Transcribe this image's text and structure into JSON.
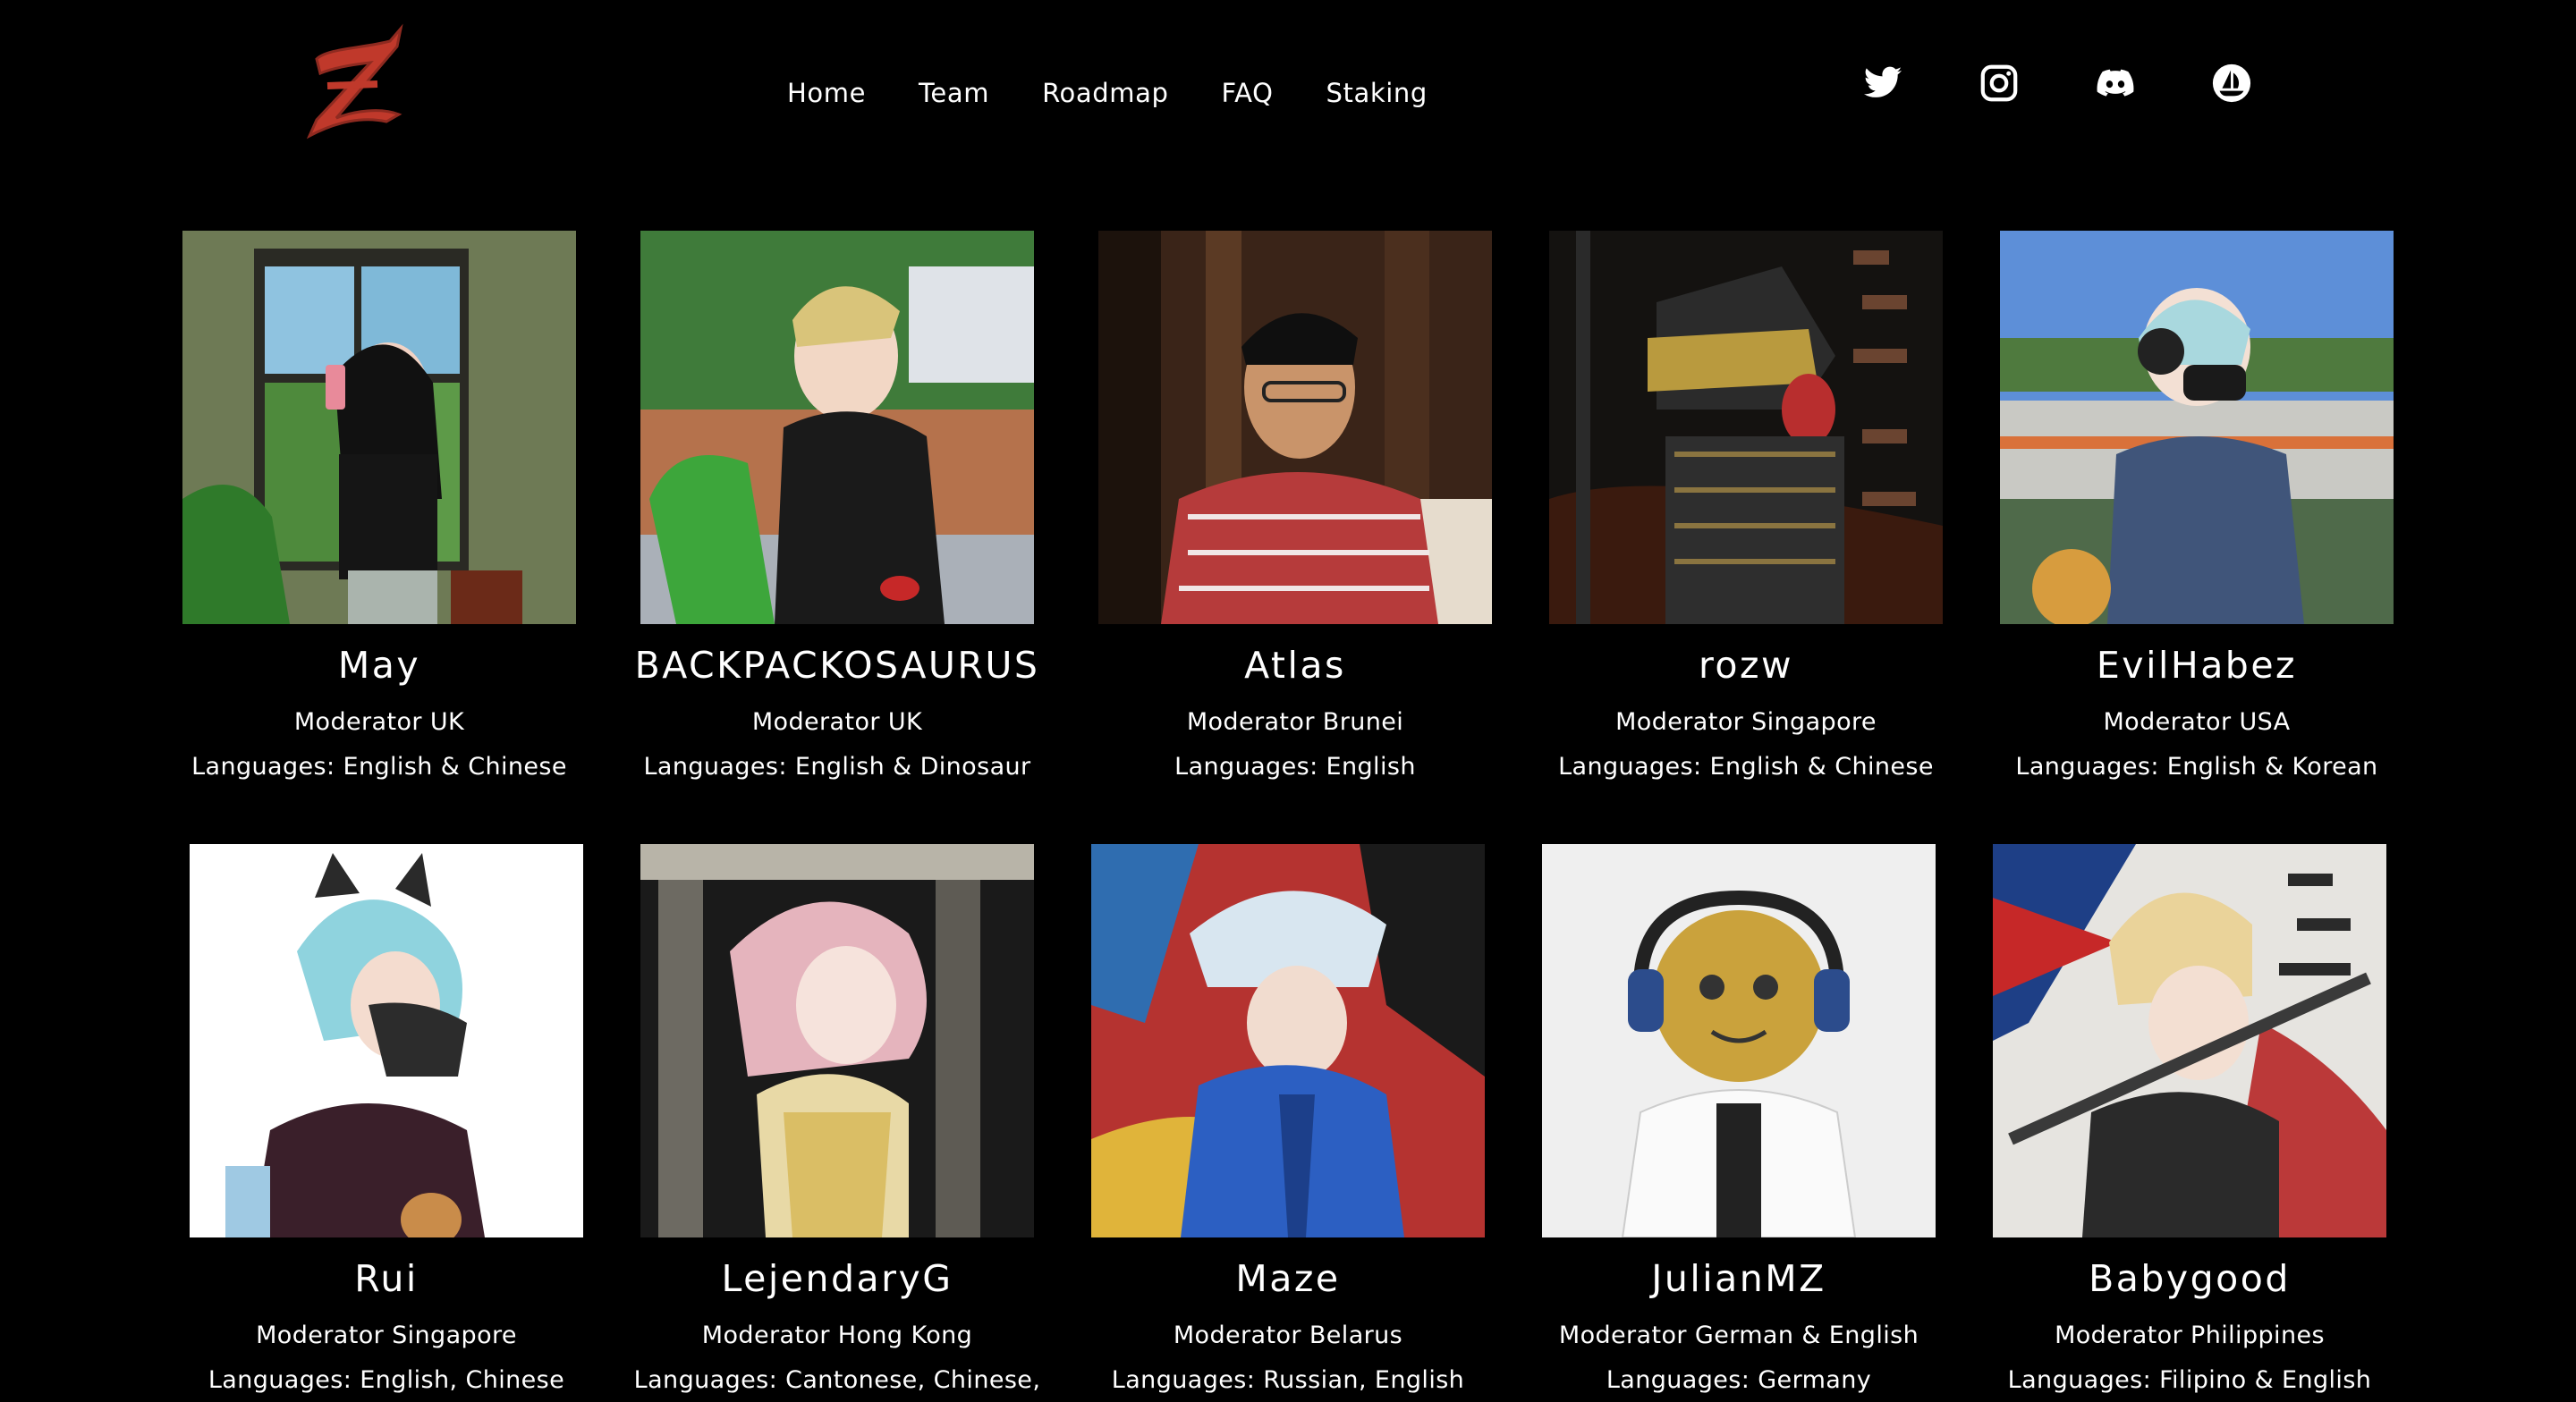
{
  "nav": {
    "logo_alt": "Z",
    "links": [
      "Home",
      "Team",
      "Roadmap",
      "FAQ",
      "Staking"
    ],
    "social_icons": [
      "twitter-icon",
      "instagram-icon",
      "discord-icon",
      "opensea-icon"
    ]
  },
  "team": [
    {
      "name": "May",
      "role": "Moderator UK",
      "languages": "Languages: English & Chinese"
    },
    {
      "name": "BACKPACKOSAURUS",
      "role": "Moderator UK",
      "languages": "Languages: English & Dinosaur"
    },
    {
      "name": "Atlas",
      "role": "Moderator Brunei",
      "languages": "Languages: English"
    },
    {
      "name": "rozw",
      "role": "Moderator Singapore",
      "languages": "Languages: English & Chinese"
    },
    {
      "name": "EvilHabez",
      "role": "Moderator USA",
      "languages": "Languages: English & Korean"
    },
    {
      "name": "Rui",
      "role": "Moderator Singapore",
      "languages": "Languages: English, Chinese"
    },
    {
      "name": "LejendaryG",
      "role": "Moderator Hong Kong",
      "languages": "Languages: Cantonese, Chinese,"
    },
    {
      "name": "Maze",
      "role": "Moderator Belarus",
      "languages": "Languages: Russian, English"
    },
    {
      "name": "JulianMZ",
      "role": "Moderator German & English",
      "languages": "Languages: Germany"
    },
    {
      "name": "Babygood",
      "role": "Moderator Philippines",
      "languages": "Languages: Filipino & English"
    }
  ]
}
